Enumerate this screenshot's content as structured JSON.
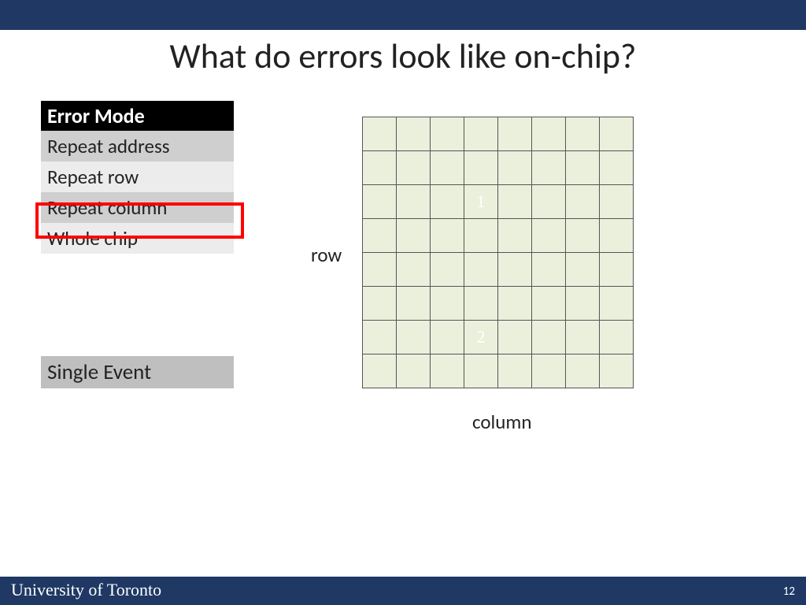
{
  "title": "What do errors look like on-chip?",
  "error_mode_header": "Error Mode",
  "error_modes": [
    "Repeat address",
    "Repeat row",
    "Repeat column",
    "Whole chip"
  ],
  "highlighted_index": 2,
  "single_event": "Single Event",
  "grid": {
    "rows": 8,
    "cols": 8,
    "row_label": "row",
    "col_label": "column"
  },
  "grid_annotations": [
    {
      "row": 2,
      "col": 3,
      "text": "1"
    },
    {
      "row": 6,
      "col": 3,
      "text": "2"
    }
  ],
  "footer": {
    "institution": "University of Toronto",
    "page_number": "12"
  }
}
